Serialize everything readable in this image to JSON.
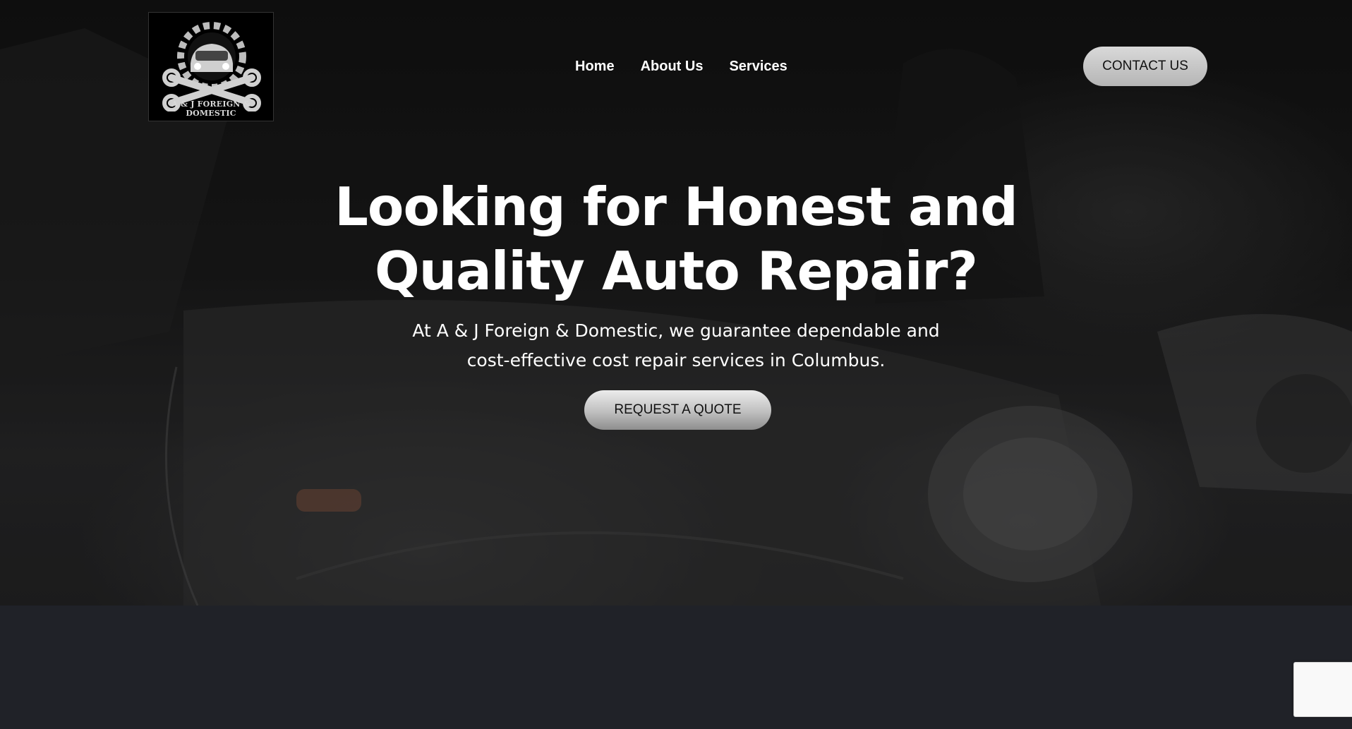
{
  "logo": {
    "text": "A & J FOREIGN & DOMESTIC"
  },
  "nav": {
    "items": [
      "Home",
      "About Us",
      "Services"
    ]
  },
  "header": {
    "contact_label": "CONTACT US"
  },
  "hero": {
    "headline_line1": "Looking for Honest and",
    "headline_line2": "Quality Auto Repair?",
    "subtext_line1": "At A & J Foreign & Domestic, we guarantee dependable and",
    "subtext_line2": "cost-effective cost repair services in Columbus.",
    "cta_label": "REQUEST A QUOTE"
  },
  "colors": {
    "page_dark": "#202228",
    "button_gray": "#c8c8c8"
  }
}
